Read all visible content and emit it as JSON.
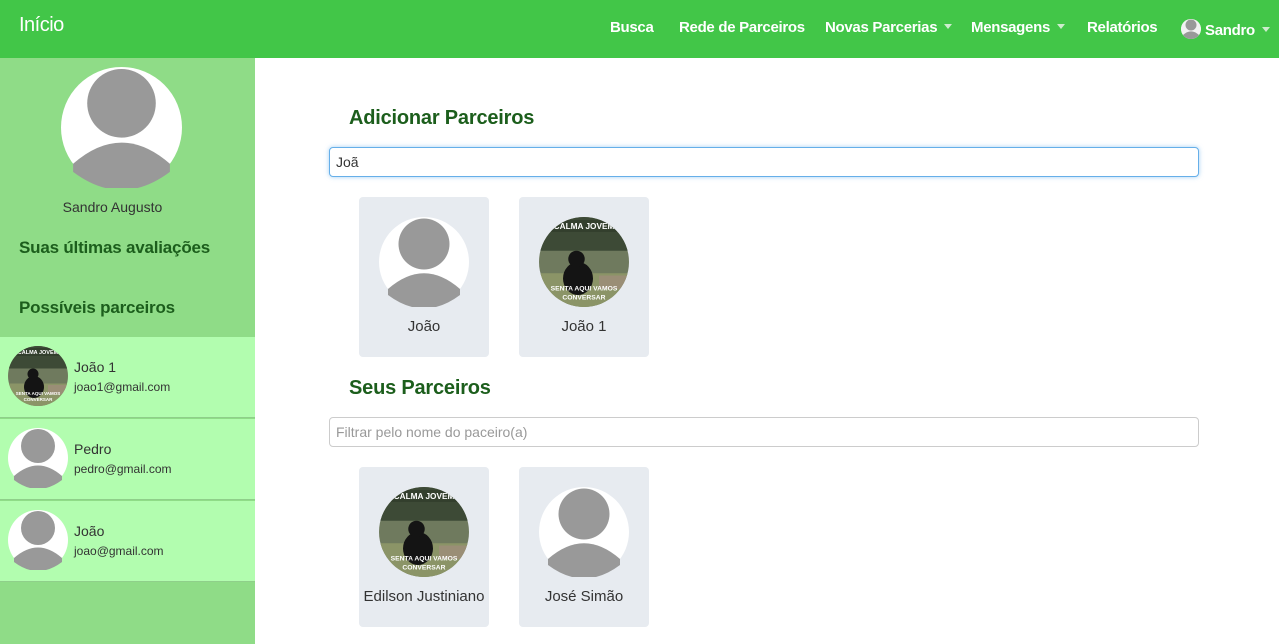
{
  "navbar": {
    "brand": "Início",
    "items": [
      {
        "label": "Busca"
      },
      {
        "label": "Rede de Parceiros"
      },
      {
        "label": "Novas Parcerias"
      },
      {
        "label": "Mensagens"
      },
      {
        "label": "Relatórios"
      },
      {
        "label": "Sandro"
      }
    ]
  },
  "sidebar": {
    "user_name": "Sandro Augusto",
    "reviews_heading": "Suas últimas avaliações",
    "possible_heading": "Possíveis parceiros",
    "possible_partners": [
      {
        "name": "João 1",
        "email": "joao1@gmail.com",
        "avatar": "bear-meme"
      },
      {
        "name": "Pedro",
        "email": "pedro@gmail.com",
        "avatar": "default-user"
      },
      {
        "name": "João",
        "email": "joao@gmail.com",
        "avatar": "default-user"
      }
    ]
  },
  "main": {
    "add_heading": "Adicionar Parceiros",
    "search_value": "Joã",
    "search_results": [
      {
        "name": "João",
        "avatar": "default-user"
      },
      {
        "name": "João 1",
        "avatar": "bear-meme"
      }
    ],
    "partners_heading": "Seus Parceiros",
    "filter_placeholder": "Filtrar pelo nome do paceiro(a)",
    "partners": [
      {
        "name": "Edilson Justiniano",
        "avatar": "bear-meme"
      },
      {
        "name": "José Simão",
        "avatar": "default-user"
      }
    ]
  },
  "meme": {
    "top_text": "CALMA JOVEM",
    "bottom_text_1": "SENTA AQUI VAMOS",
    "bottom_text_2": "CONVERSAR"
  },
  "colors": {
    "navbar": "#42c648",
    "sidebar": "#8fdc87",
    "partner_row": "#b2fdaf",
    "heading": "#1c5e1c",
    "card": "#e7ebf0"
  }
}
